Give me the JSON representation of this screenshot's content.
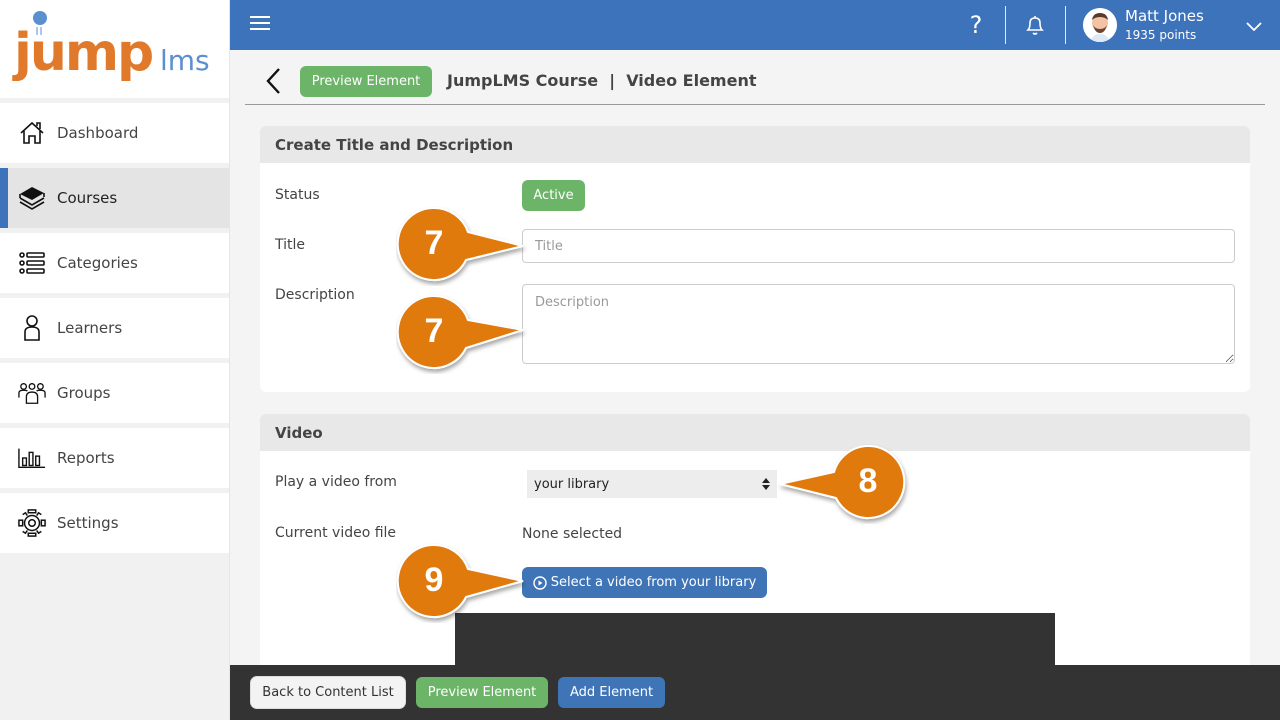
{
  "app": {
    "logo_main": "jump",
    "logo_suffix": "lms"
  },
  "sidebar": {
    "items": [
      {
        "label": "Dashboard",
        "icon": "home-icon",
        "active": false
      },
      {
        "label": "Courses",
        "icon": "books-icon",
        "active": true
      },
      {
        "label": "Categories",
        "icon": "list-icon",
        "active": false
      },
      {
        "label": "Learners",
        "icon": "person-icon",
        "active": false
      },
      {
        "label": "Groups",
        "icon": "group-icon",
        "active": false
      },
      {
        "label": "Reports",
        "icon": "bar-chart-icon",
        "active": false
      },
      {
        "label": "Settings",
        "icon": "gear-icon",
        "active": false
      }
    ]
  },
  "topbar": {
    "help_glyph": "?",
    "user": {
      "name": "Matt Jones",
      "points": "1935 points"
    }
  },
  "header": {
    "preview_label": "Preview Element",
    "title": "JumpLMS Course  |  Video Element"
  },
  "title_section": {
    "heading": "Create Title and Description",
    "status_label": "Status",
    "status_value": "Active",
    "title_label": "Title",
    "title_placeholder": "Title",
    "title_value": "",
    "description_label": "Description",
    "description_placeholder": "Description",
    "description_value": ""
  },
  "video_section": {
    "heading": "Video",
    "source_label": "Play a video from",
    "source_value": "your library",
    "current_label": "Current video file",
    "current_value": "None selected",
    "select_button": "Select a video from your library"
  },
  "footer": {
    "back_label": "Back to Content List",
    "preview_label": "Preview Element",
    "add_label": "Add Element"
  },
  "callouts": [
    {
      "number": "7",
      "target": "title-input"
    },
    {
      "number": "7",
      "target": "description-input"
    },
    {
      "number": "8",
      "target": "video-source-select"
    },
    {
      "number": "9",
      "target": "select-video-button"
    }
  ],
  "colors": {
    "primary": "#3c73bb",
    "success": "#6bb468",
    "callout": "#e07a10",
    "logo_orange": "#e07a2a",
    "logo_blue": "#5a8fd0",
    "footer": "#333333"
  }
}
